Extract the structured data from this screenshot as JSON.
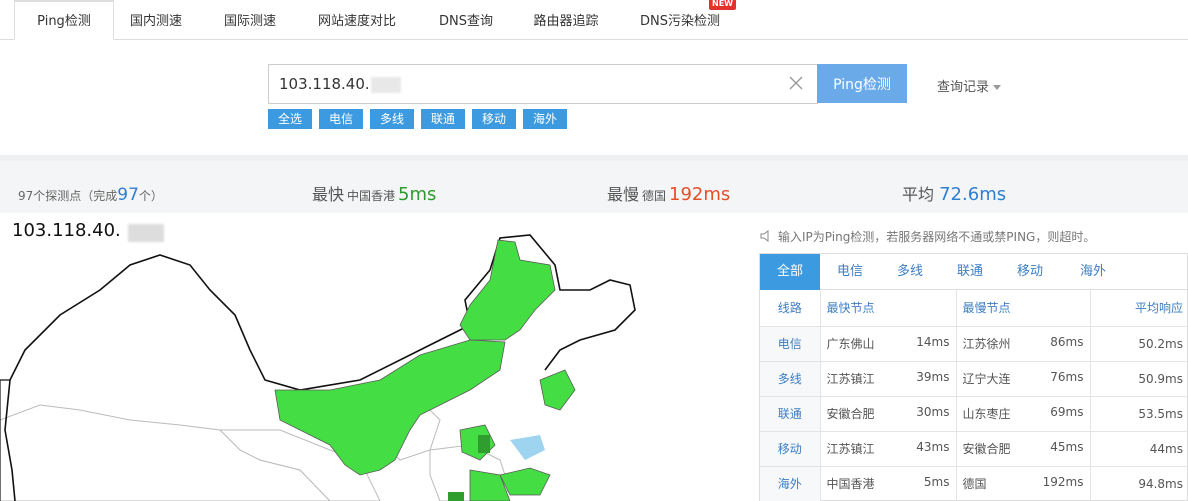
{
  "tabs": [
    {
      "label": "Ping检测",
      "active": true
    },
    {
      "label": "国内测速"
    },
    {
      "label": "国际测速"
    },
    {
      "label": "网站速度对比"
    },
    {
      "label": "DNS查询"
    },
    {
      "label": "路由器追踪"
    },
    {
      "label": "DNS污染检测",
      "badge": "NEW"
    }
  ],
  "search": {
    "value": "103.118.40.",
    "button": "Ping检测",
    "history": "查询记录"
  },
  "chips": [
    "全选",
    "电信",
    "多线",
    "联通",
    "移动",
    "海外"
  ],
  "stats": {
    "count_prefix": "97个探测点（完成",
    "done": "97",
    "count_suffix": "个）",
    "fast_label": "最快",
    "fast_loc": "中国香港",
    "fast_val": "5ms",
    "slow_label": "最慢",
    "slow_loc": "德国",
    "slow_val": "192ms",
    "avg_label": "平均",
    "avg_val": "72.6ms"
  },
  "ip_title": "103.118.40.",
  "notice": "输入IP为Ping检测，若服务器网络不通或禁PING，则超时。",
  "panel": {
    "tabs": [
      "全部",
      "电信",
      "多线",
      "联通",
      "移动",
      "海外"
    ],
    "headers": {
      "line": "线路",
      "fast": "最快节点",
      "slow": "最慢节点",
      "avg": "平均响应"
    },
    "rows": [
      {
        "line": "电信",
        "fast_node": "广东佛山",
        "fast_ms": "14ms",
        "slow_node": "江苏徐州",
        "slow_ms": "86ms",
        "avg": "50.2ms"
      },
      {
        "line": "多线",
        "fast_node": "江苏镇江",
        "fast_ms": "39ms",
        "slow_node": "辽宁大连",
        "slow_ms": "76ms",
        "avg": "50.9ms"
      },
      {
        "line": "联通",
        "fast_node": "安徽合肥",
        "fast_ms": "30ms",
        "slow_node": "山东枣庄",
        "slow_ms": "69ms",
        "avg": "53.5ms"
      },
      {
        "line": "移动",
        "fast_node": "江苏镇江",
        "fast_ms": "43ms",
        "slow_node": "安徽合肥",
        "slow_ms": "45ms",
        "avg": "44ms"
      },
      {
        "line": "海外",
        "fast_node": "中国香港",
        "fast_ms": "5ms",
        "slow_node": "德国",
        "slow_ms": "192ms",
        "avg": "94.8ms"
      }
    ]
  },
  "colors": {
    "accent": "#3c9ae0",
    "button": "#6aaae8",
    "map_fill": "#44dd44",
    "map_dark": "#2f9e2f",
    "fast": "#2e9a2e",
    "slow": "#e2502a"
  }
}
